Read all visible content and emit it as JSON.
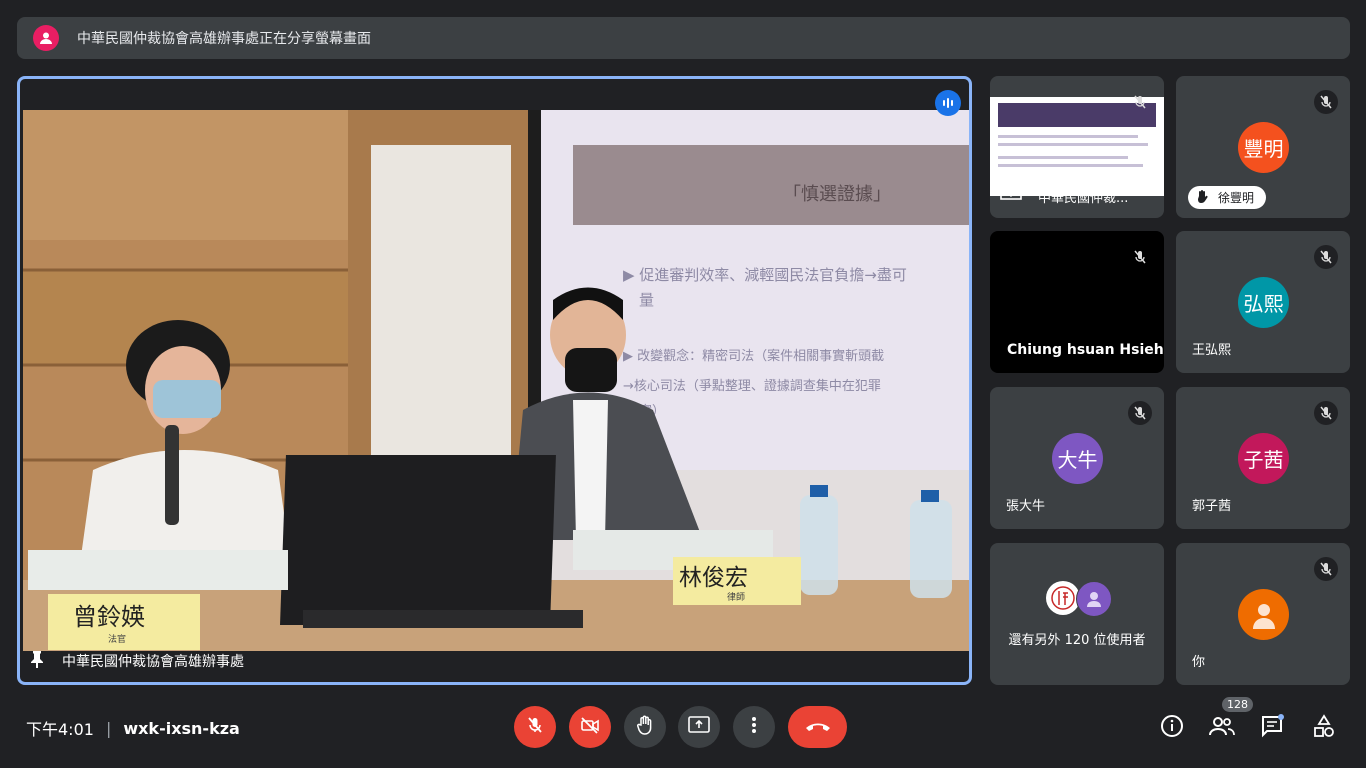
{
  "banner": {
    "text": "中華民國仲裁協會高雄辦事處正在分享螢幕畫面"
  },
  "main": {
    "presenter_label": "中華民國仲裁協會高雄辦事處",
    "slide_title": "「慎選證據」",
    "slide_lines": [
      "▶ 促進審判效率、減輕國民法官負擔→盡可",
      "量",
      "▶ 改變觀念：精密司法（案件相關事實斬頭截",
      "→核心司法（爭點整理、證據調查集中在犯罪",
      "實）"
    ],
    "nameplate_left_name": "曾鈴媖",
    "nameplate_left_title": "法官",
    "nameplate_right_name": "林俊宏",
    "nameplate_right_title": "律師"
  },
  "tiles": [
    {
      "name": "中華民國仲裁...",
      "type": "screen"
    },
    {
      "name": "徐豐明",
      "initials": "豐明",
      "color": "#f4511e",
      "hand": true
    },
    {
      "name": "Chiung hsuan Hsieh",
      "type": "dark"
    },
    {
      "name": "王弘熙",
      "initials": "弘熙",
      "color": "#0097a7"
    },
    {
      "name": "張大牛",
      "initials": "大牛",
      "color": "#7e57c2"
    },
    {
      "name": "郭子茜",
      "initials": "子茜",
      "color": "#c2185b"
    },
    {
      "name": "還有另外 120 位使用者",
      "type": "more"
    },
    {
      "name": "你",
      "type": "you"
    }
  ],
  "bottom": {
    "time": "下午4:01",
    "separator": "|",
    "meeting_code": "wxk-ixsn-kza",
    "people_count": "128"
  },
  "colors": {
    "accent": "#8ab4f8",
    "red": "#ea4335",
    "blue": "#1a73e8"
  }
}
